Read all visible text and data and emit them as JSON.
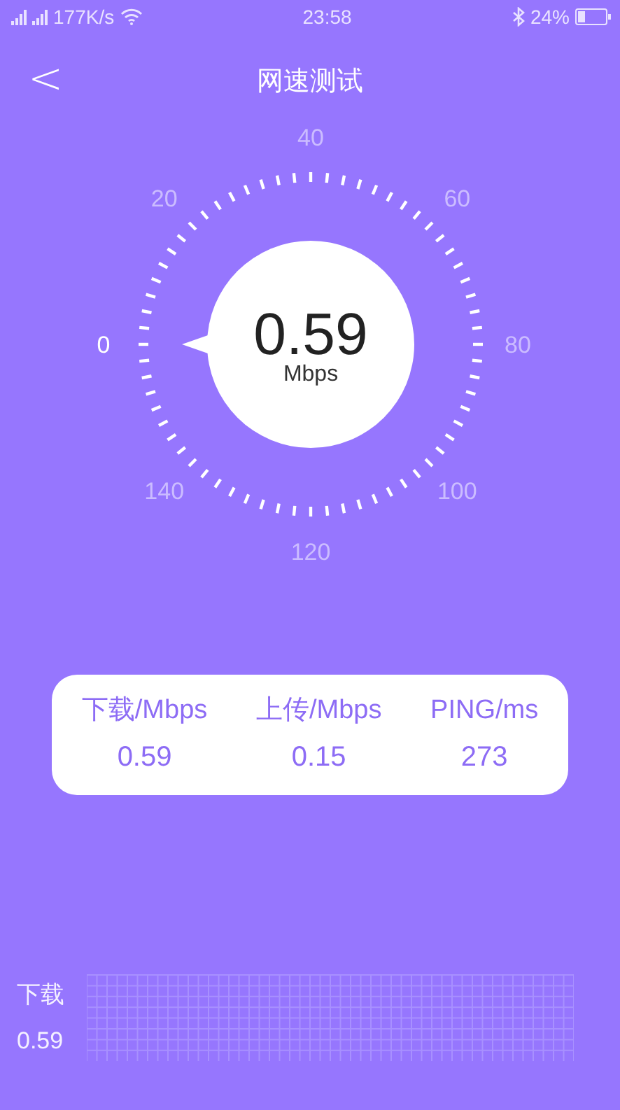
{
  "status_bar": {
    "speed": "177K/s",
    "time": "23:58",
    "battery": "24%"
  },
  "header": {
    "back": "<",
    "title": "网速测试"
  },
  "gauge": {
    "value": "0.59",
    "unit": "Mbps",
    "scale": [
      {
        "label": "0",
        "highlighted": true
      },
      {
        "label": "20",
        "highlighted": false
      },
      {
        "label": "40",
        "highlighted": false
      },
      {
        "label": "60",
        "highlighted": false
      },
      {
        "label": "80",
        "highlighted": false
      },
      {
        "label": "100",
        "highlighted": false
      },
      {
        "label": "120",
        "highlighted": false
      },
      {
        "label": "140",
        "highlighted": false
      }
    ]
  },
  "stats": [
    {
      "label": "下载/Mbps",
      "value": "0.59"
    },
    {
      "label": "上传/Mbps",
      "value": "0.15"
    },
    {
      "label": "PING/ms",
      "value": "273"
    }
  ],
  "history": {
    "label": "下载",
    "value": "0.59"
  }
}
